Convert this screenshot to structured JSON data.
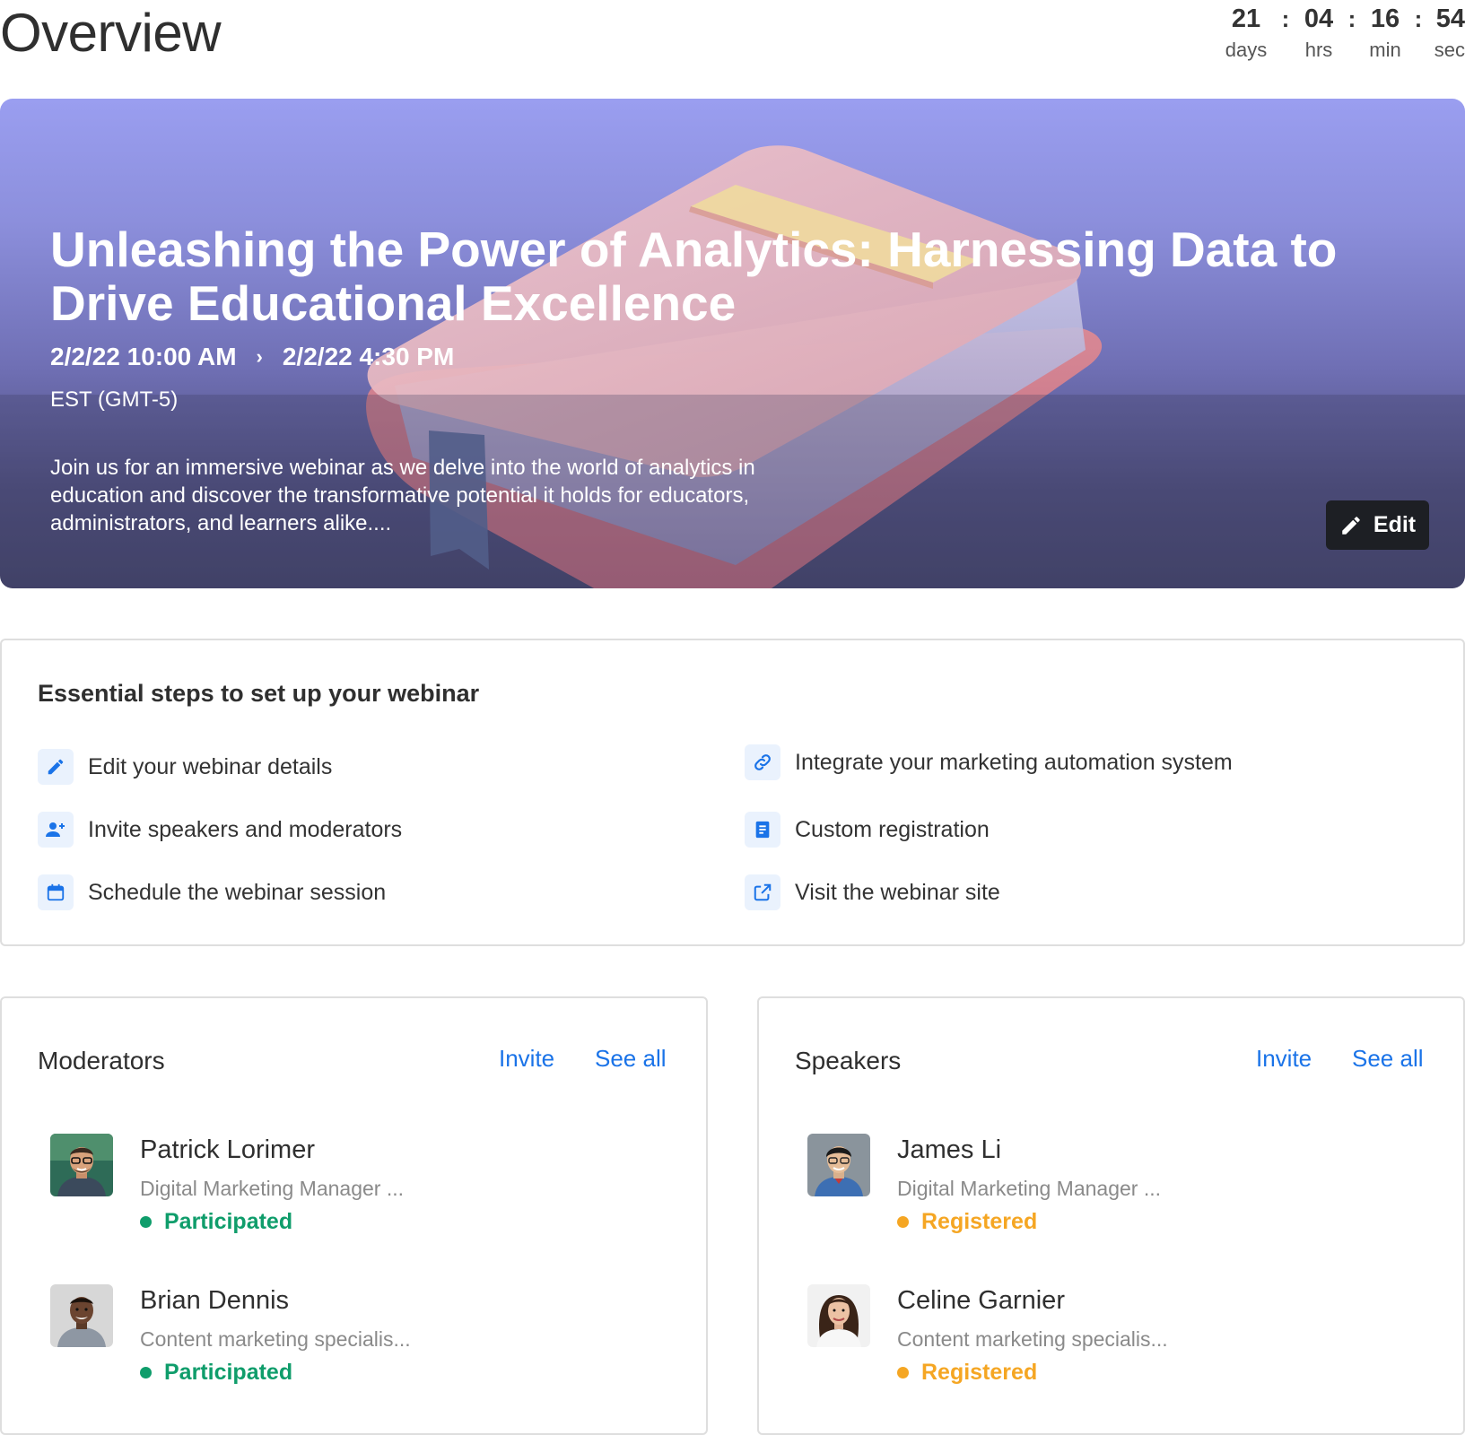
{
  "page": {
    "title": "Overview"
  },
  "countdown": [
    {
      "value": "21",
      "unit": "days"
    },
    {
      "value": "04",
      "unit": "hrs"
    },
    {
      "value": "16",
      "unit": "min"
    },
    {
      "value": "54",
      "unit": "sec"
    }
  ],
  "countdown_separator": ":",
  "hero": {
    "title": "Unleashing the Power of Analytics: Harnessing Data to Drive Educational Excellence",
    "start": "2/2/22 10:00 AM",
    "end": "2/2/22 4:30 PM",
    "timezone": "EST (GMT-5)",
    "description": "Join us for an immersive webinar as we delve into the world of analytics in education and discover the transformative potential it holds for educators, administrators, and learners alike....",
    "edit_label": "Edit"
  },
  "steps": {
    "title": "Essential steps to set up your webinar",
    "items": [
      {
        "label": "Edit your webinar details",
        "icon": "pencil-icon"
      },
      {
        "label": "Invite speakers and moderators",
        "icon": "add-user-icon"
      },
      {
        "label": "Schedule the webinar session",
        "icon": "calendar-icon"
      },
      {
        "label": "Integrate your marketing automation system",
        "icon": "link-icon"
      },
      {
        "label": "Custom registration",
        "icon": "form-icon"
      },
      {
        "label": "Visit the webinar site",
        "icon": "external-link-icon"
      }
    ]
  },
  "moderators": {
    "title": "Moderators",
    "invite": "Invite",
    "see_all": "See all",
    "people": [
      {
        "name": "Patrick Lorimer",
        "role": "Digital Marketing Manager ...",
        "status": "Participated"
      },
      {
        "name": "Brian Dennis",
        "role": "Content marketing specialis...",
        "status": "Participated"
      }
    ]
  },
  "speakers": {
    "title": "Speakers",
    "invite": "Invite",
    "see_all": "See all",
    "people": [
      {
        "name": "James Li",
        "role": "Digital Marketing Manager ...",
        "status": "Registered"
      },
      {
        "name": "Celine Garnier",
        "role": "Content marketing specialis...",
        "status": "Registered"
      }
    ]
  },
  "colors": {
    "accent": "#1a73e8",
    "participated": "#0f9d6b",
    "registered": "#f5a623",
    "edit_button": "#1d1f24"
  }
}
